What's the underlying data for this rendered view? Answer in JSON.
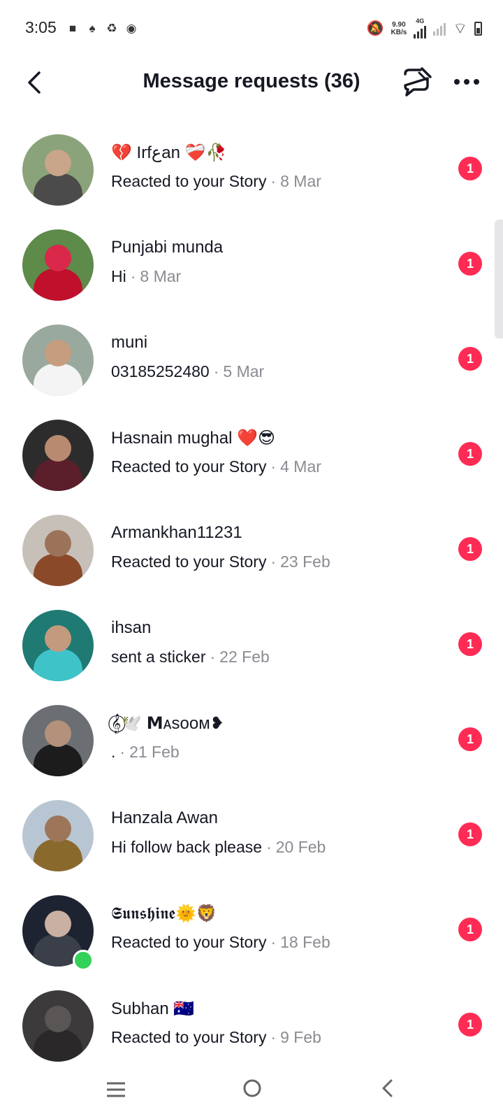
{
  "status_bar": {
    "time": "3:05",
    "net_speed": "9.90",
    "net_unit": "KB/s",
    "network_type": "4G"
  },
  "header": {
    "title": "Message requests (36)"
  },
  "requests": [
    {
      "name": "💔 Irfعan ❤️‍🩹🥀",
      "message": "Reacted to your Story",
      "date": "8 Mar",
      "unread": "1",
      "avatar_bg": "#8aa37a",
      "avatar_fig": "#c9a58a",
      "avatar_body": "#4b4b4b",
      "online": false
    },
    {
      "name": "Punjabi munda",
      "message": "Hi",
      "date": "8 Mar",
      "unread": "1",
      "avatar_bg": "#5e8a4a",
      "avatar_fig": "#d9284a",
      "avatar_body": "#c0102c",
      "online": false
    },
    {
      "name": "muni",
      "message": "03185252480",
      "date": "5 Mar",
      "unread": "1",
      "avatar_bg": "#9aa99e",
      "avatar_fig": "#c79d7f",
      "avatar_body": "#f4f4f4",
      "online": false
    },
    {
      "name": "Hasnain mughal ❤️😎",
      "message": "Reacted to your Story",
      "date": "4 Mar",
      "unread": "1",
      "avatar_bg": "#2c2c2c",
      "avatar_fig": "#b88a70",
      "avatar_body": "#5a1f2a",
      "online": false
    },
    {
      "name": "Armankhan11231",
      "message": "Reacted to your Story",
      "date": "23 Feb",
      "unread": "1",
      "avatar_bg": "#c7c0b8",
      "avatar_fig": "#9b7359",
      "avatar_body": "#8a4a2a",
      "online": false
    },
    {
      "name": "ihsan",
      "message": "sent a sticker",
      "date": "22 Feb",
      "unread": "1",
      "avatar_bg": "#1f7a73",
      "avatar_fig": "#c39a7e",
      "avatar_body": "#3ec3c9",
      "online": false
    },
    {
      "name": "𝄞⃝🕊️ 𝗠ᴀsᴏᴏᴍ❥",
      "message": ".",
      "date": "21 Feb",
      "unread": "1",
      "avatar_bg": "#6b6f73",
      "avatar_fig": "#b3917a",
      "avatar_body": "#1c1c1c",
      "online": false
    },
    {
      "name": "Hanzala Awan",
      "message": "Hi follow back please",
      "date": "20 Feb",
      "unread": "1",
      "avatar_bg": "#b7c6d2",
      "avatar_fig": "#9d7558",
      "avatar_body": "#8a6a2c",
      "online": false
    },
    {
      "name": "𝕾𝖚𝖓𝖘𝖍𝖎𝖓𝖊🌞🦁",
      "message": "Reacted to your Story",
      "date": "18 Feb",
      "unread": "1",
      "avatar_bg": "#1d2330",
      "avatar_fig": "#c9b0a2",
      "avatar_body": "#3a3f4a",
      "online": true
    },
    {
      "name": "Subhan 🇦🇺",
      "message": "Reacted to your Story",
      "date": "9 Feb",
      "unread": "1",
      "avatar_bg": "#3c3a3a",
      "avatar_fig": "#5a5656",
      "avatar_body": "#2a2828",
      "online": false
    }
  ],
  "nav_bar": {
    "recent_icon": "☰",
    "home_icon": "○",
    "back_icon": "<"
  }
}
